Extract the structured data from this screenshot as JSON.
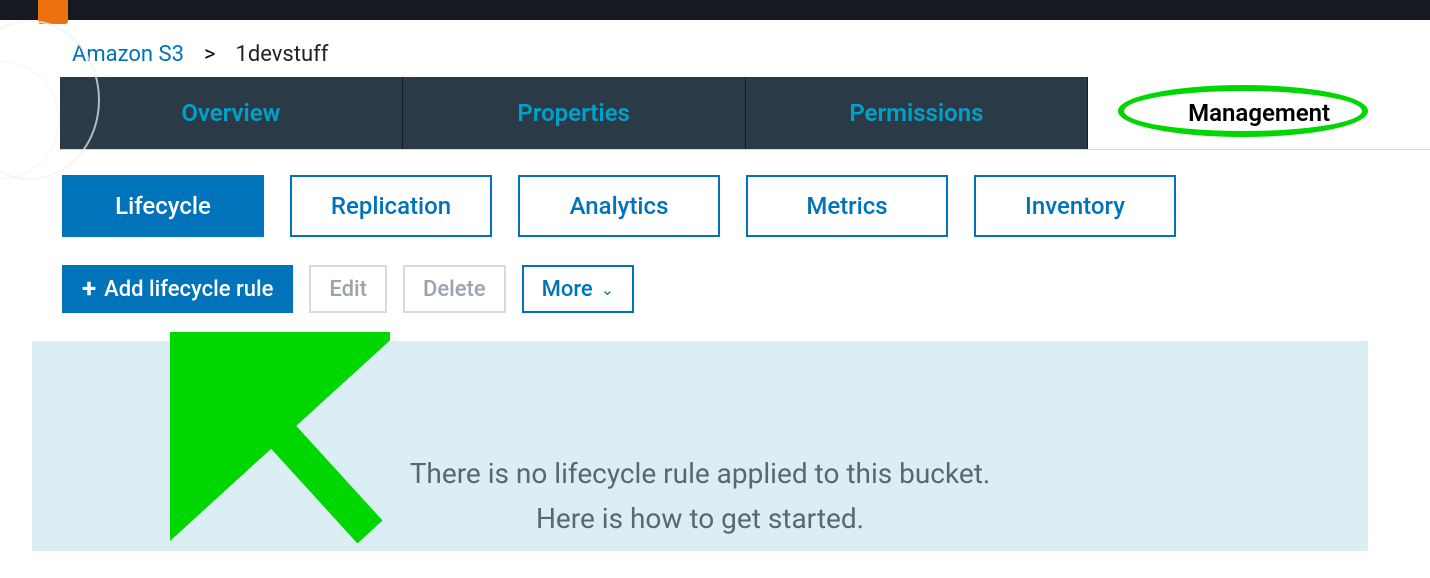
{
  "breadcrumb": {
    "service": "Amazon S3",
    "separator": ">",
    "bucket": "1devstuff"
  },
  "tabs": {
    "overview": "Overview",
    "properties": "Properties",
    "permissions": "Permissions",
    "management": "Management"
  },
  "subtabs": {
    "lifecycle": "Lifecycle",
    "replication": "Replication",
    "analytics": "Analytics",
    "metrics": "Metrics",
    "inventory": "Inventory"
  },
  "actions": {
    "add": "Add lifecycle rule",
    "edit": "Edit",
    "delete": "Delete",
    "more": "More"
  },
  "empty": {
    "line1": "There is no lifecycle rule applied to this bucket.",
    "line2": "Here is how to get started."
  }
}
